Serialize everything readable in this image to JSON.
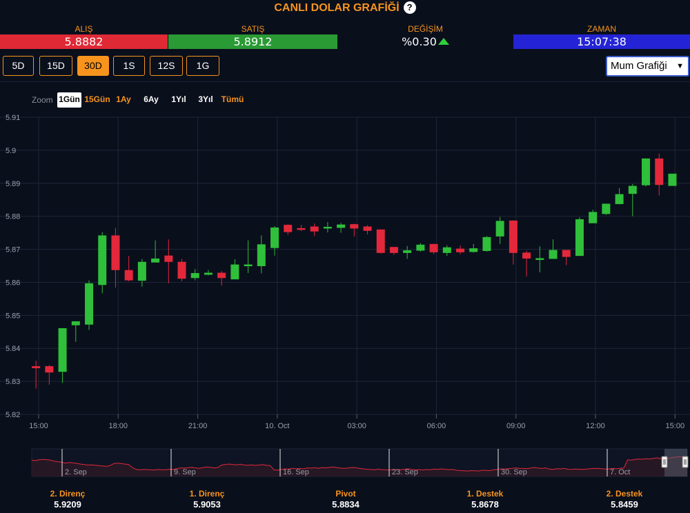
{
  "header": {
    "title": "CANLI DOLAR GRAFİĞİ",
    "help_glyph": "?"
  },
  "quotes": {
    "alis": {
      "label": "ALIŞ",
      "value": "5.8882"
    },
    "satis": {
      "label": "SATIŞ",
      "value": "5.8912"
    },
    "degisim": {
      "label": "DEĞİŞİM",
      "value": "%0.30",
      "direction": "up"
    },
    "zaman": {
      "label": "ZAMAN",
      "value": "15:07:38"
    }
  },
  "periods": [
    {
      "label": "5D",
      "active": false
    },
    {
      "label": "15D",
      "active": false
    },
    {
      "label": "30D",
      "active": true
    },
    {
      "label": "1S",
      "active": false
    },
    {
      "label": "12S",
      "active": false
    },
    {
      "label": "1G",
      "active": false
    }
  ],
  "chart_type_select": {
    "selected": "Mum Grafiği"
  },
  "zoom": {
    "label": "Zoom",
    "options": [
      {
        "label": "1Gün",
        "style": "selected"
      },
      {
        "label": "15Gün",
        "style": "orange"
      },
      {
        "label": "1Ay",
        "style": "orange"
      },
      {
        "label": "6Ay",
        "style": "white"
      },
      {
        "label": "1Yıl",
        "style": "white"
      },
      {
        "label": "3Yıl",
        "style": "white"
      },
      {
        "label": "Tümü",
        "style": "orange"
      }
    ]
  },
  "colors": {
    "accent": "#f7941d",
    "up": "#2fbf3a",
    "down": "#e3283b",
    "alis_bg": "#df2a36",
    "satis_bg": "#2a9a35",
    "zaman_bg": "#2424d6",
    "navigator_line": "#e3283b"
  },
  "chart_data": {
    "type": "candlestick",
    "y_ticks": [
      "5.91",
      "5.9",
      "5.89",
      "5.88",
      "5.87",
      "5.86",
      "5.85",
      "5.84",
      "5.83",
      "5.82"
    ],
    "ylim": [
      5.82,
      5.91
    ],
    "x_ticks": [
      "15:00",
      "18:00",
      "21:00",
      "10. Oct",
      "03:00",
      "06:00",
      "09:00",
      "12:00",
      "15:00"
    ],
    "x_range_hours": [
      0,
      24.2
    ],
    "grid": true,
    "candles": [
      {
        "t": -0.1,
        "o": 5.8345,
        "h": 5.8363,
        "l": 5.8278,
        "c": 5.8341
      },
      {
        "t": 0.4,
        "o": 5.8345,
        "h": 5.835,
        "l": 5.829,
        "c": 5.8328
      },
      {
        "t": 0.9,
        "o": 5.833,
        "h": 5.8462,
        "l": 5.8295,
        "c": 5.846
      },
      {
        "t": 1.4,
        "o": 5.8471,
        "h": 5.848,
        "l": 5.842,
        "c": 5.8481
      },
      {
        "t": 1.9,
        "o": 5.8473,
        "h": 5.8606,
        "l": 5.8456,
        "c": 5.8596
      },
      {
        "t": 2.4,
        "o": 5.8593,
        "h": 5.8752,
        "l": 5.8567,
        "c": 5.8741
      },
      {
        "t": 2.9,
        "o": 5.8741,
        "h": 5.8765,
        "l": 5.8584,
        "c": 5.8638
      },
      {
        "t": 3.4,
        "o": 5.8636,
        "h": 5.868,
        "l": 5.8603,
        "c": 5.8607
      },
      {
        "t": 3.9,
        "o": 5.8606,
        "h": 5.8671,
        "l": 5.8587,
        "c": 5.8661
      },
      {
        "t": 4.4,
        "o": 5.8661,
        "h": 5.8727,
        "l": 5.8661,
        "c": 5.8671
      },
      {
        "t": 4.9,
        "o": 5.868,
        "h": 5.873,
        "l": 5.8597,
        "c": 5.8663
      },
      {
        "t": 5.4,
        "o": 5.8661,
        "h": 5.8671,
        "l": 5.8603,
        "c": 5.8612
      },
      {
        "t": 5.9,
        "o": 5.8614,
        "h": 5.864,
        "l": 5.8606,
        "c": 5.8627
      },
      {
        "t": 6.4,
        "o": 5.8624,
        "h": 5.8637,
        "l": 5.8621,
        "c": 5.8628
      },
      {
        "t": 6.9,
        "o": 5.8628,
        "h": 5.8634,
        "l": 5.859,
        "c": 5.8614
      },
      {
        "t": 7.4,
        "o": 5.861,
        "h": 5.867,
        "l": 5.861,
        "c": 5.8653
      },
      {
        "t": 7.9,
        "o": 5.865,
        "h": 5.8727,
        "l": 5.8628,
        "c": 5.8653
      },
      {
        "t": 8.4,
        "o": 5.865,
        "h": 5.8742,
        "l": 5.8627,
        "c": 5.8714
      },
      {
        "t": 8.9,
        "o": 5.8705,
        "h": 5.877,
        "l": 5.8681,
        "c": 5.8765
      },
      {
        "t": 9.4,
        "o": 5.8773,
        "h": 5.8776,
        "l": 5.8744,
        "c": 5.8753
      },
      {
        "t": 9.9,
        "o": 5.8763,
        "h": 5.8774,
        "l": 5.8755,
        "c": 5.876
      },
      {
        "t": 10.4,
        "o": 5.8768,
        "h": 5.8778,
        "l": 5.874,
        "c": 5.8755
      },
      {
        "t": 10.9,
        "o": 5.8764,
        "h": 5.8782,
        "l": 5.8751,
        "c": 5.8767
      },
      {
        "t": 11.4,
        "o": 5.8766,
        "h": 5.878,
        "l": 5.875,
        "c": 5.8774
      },
      {
        "t": 11.9,
        "o": 5.8775,
        "h": 5.8778,
        "l": 5.8739,
        "c": 5.8764
      },
      {
        "t": 12.4,
        "o": 5.8768,
        "h": 5.8773,
        "l": 5.8745,
        "c": 5.8757
      },
      {
        "t": 12.9,
        "o": 5.8759,
        "h": 5.876,
        "l": 5.8687,
        "c": 5.869
      },
      {
        "t": 13.4,
        "o": 5.8706,
        "h": 5.8706,
        "l": 5.8683,
        "c": 5.869
      },
      {
        "t": 13.9,
        "o": 5.869,
        "h": 5.871,
        "l": 5.8671,
        "c": 5.8696
      },
      {
        "t": 14.4,
        "o": 5.8697,
        "h": 5.8719,
        "l": 5.8693,
        "c": 5.8713
      },
      {
        "t": 14.9,
        "o": 5.8715,
        "h": 5.8717,
        "l": 5.8685,
        "c": 5.8692
      },
      {
        "t": 15.4,
        "o": 5.869,
        "h": 5.8712,
        "l": 5.868,
        "c": 5.8705
      },
      {
        "t": 15.9,
        "o": 5.8701,
        "h": 5.8712,
        "l": 5.8685,
        "c": 5.8692
      },
      {
        "t": 16.4,
        "o": 5.8693,
        "h": 5.8716,
        "l": 5.869,
        "c": 5.8702
      },
      {
        "t": 16.9,
        "o": 5.8696,
        "h": 5.874,
        "l": 5.8693,
        "c": 5.8736
      },
      {
        "t": 17.4,
        "o": 5.874,
        "h": 5.8798,
        "l": 5.8716,
        "c": 5.8785
      },
      {
        "t": 17.9,
        "o": 5.8786,
        "h": 5.8788,
        "l": 5.8654,
        "c": 5.869
      },
      {
        "t": 18.4,
        "o": 5.8689,
        "h": 5.8696,
        "l": 5.8618,
        "c": 5.8673
      },
      {
        "t": 18.9,
        "o": 5.8672,
        "h": 5.8709,
        "l": 5.863,
        "c": 5.8672
      },
      {
        "t": 19.4,
        "o": 5.8672,
        "h": 5.873,
        "l": 5.8671,
        "c": 5.8697
      },
      {
        "t": 19.9,
        "o": 5.8697,
        "h": 5.8698,
        "l": 5.8652,
        "c": 5.8678
      },
      {
        "t": 20.4,
        "o": 5.8681,
        "h": 5.8797,
        "l": 5.8681,
        "c": 5.879
      },
      {
        "t": 20.9,
        "o": 5.878,
        "h": 5.882,
        "l": 5.8781,
        "c": 5.8812
      },
      {
        "t": 21.4,
        "o": 5.8808,
        "h": 5.8838,
        "l": 5.8804,
        "c": 5.8837
      },
      {
        "t": 21.9,
        "o": 5.8838,
        "h": 5.8886,
        "l": 5.8836,
        "c": 5.8866
      },
      {
        "t": 22.4,
        "o": 5.8869,
        "h": 5.8898,
        "l": 5.88,
        "c": 5.8891
      },
      {
        "t": 22.9,
        "o": 5.8895,
        "h": 5.8975,
        "l": 5.889,
        "c": 5.8974
      },
      {
        "t": 23.4,
        "o": 5.8974,
        "h": 5.899,
        "l": 5.8863,
        "c": 5.8896
      },
      {
        "t": 23.9,
        "o": 5.8893,
        "h": 5.8928,
        "l": 5.8893,
        "c": 5.8928
      }
    ],
    "navigator": {
      "x_ticks": [
        "2. Sep",
        "9. Sep",
        "16. Sep",
        "23. Sep",
        "30. Sep",
        "7. Oct"
      ],
      "series": [
        0.7,
        0.68,
        0.72,
        0.74,
        0.73,
        0.7,
        0.65,
        0.62,
        0.6,
        0.55,
        0.58,
        0.56,
        0.54,
        0.5,
        0.48,
        0.45,
        0.46,
        0.44,
        0.42,
        0.4,
        0.38,
        0.42,
        0.52,
        0.55,
        0.53,
        0.5,
        0.48,
        0.32,
        0.22,
        0.2,
        0.22,
        0.21,
        0.2,
        0.19,
        0.22,
        0.2,
        0.21,
        0.23,
        0.22,
        0.26,
        0.3,
        0.29,
        0.31,
        0.33,
        0.3,
        0.28,
        0.32,
        0.35,
        0.33,
        0.3,
        0.32,
        0.45,
        0.48,
        0.5,
        0.47,
        0.46,
        0.49,
        0.45,
        0.44,
        0.46,
        0.43,
        0.45,
        0.47,
        0.44,
        0.42,
        0.2,
        0.18,
        0.22,
        0.25,
        0.24,
        0.28,
        0.26,
        0.27,
        0.25,
        0.3,
        0.29,
        0.31,
        0.28,
        0.32,
        0.3,
        0.33,
        0.35,
        0.31,
        0.29,
        0.28,
        0.3,
        0.32,
        0.31,
        0.27,
        0.25,
        0.23,
        0.22,
        0.2,
        0.24,
        0.21,
        0.2,
        0.19,
        0.22,
        0.21,
        0.2,
        0.23,
        0.25,
        0.22,
        0.2,
        0.21,
        0.19,
        0.22,
        0.2,
        0.24,
        0.22,
        0.25,
        0.23,
        0.21,
        0.22,
        0.18,
        0.16,
        0.15,
        0.14,
        0.16,
        0.15,
        0.14,
        0.18,
        0.17,
        0.16,
        0.2,
        0.22,
        0.25,
        0.24,
        0.26,
        0.28,
        0.3,
        0.28,
        0.27,
        0.26,
        0.3,
        0.32,
        0.29,
        0.28,
        0.3,
        0.24,
        0.22,
        0.26,
        0.25,
        0.27,
        0.23,
        0.22,
        0.24,
        0.23,
        0.22,
        0.24,
        0.26,
        0.28,
        0.27,
        0.26,
        0.24,
        0.25,
        0.27,
        0.26,
        0.28,
        0.3,
        0.72,
        0.7,
        0.74,
        0.76,
        0.75,
        0.78,
        0.76,
        0.8,
        0.82,
        0.78,
        0.76,
        0.8,
        0.84,
        0.86,
        0.88,
        0.86,
        0.9
      ]
    }
  },
  "pivots": [
    {
      "label": "2. Direnç",
      "value": "5.9209"
    },
    {
      "label": "1. Direnç",
      "value": "5.9053"
    },
    {
      "label": "Pivot",
      "value": "5.8834"
    },
    {
      "label": "1. Destek",
      "value": "5.8678"
    },
    {
      "label": "2. Destek",
      "value": "5.8459"
    }
  ]
}
